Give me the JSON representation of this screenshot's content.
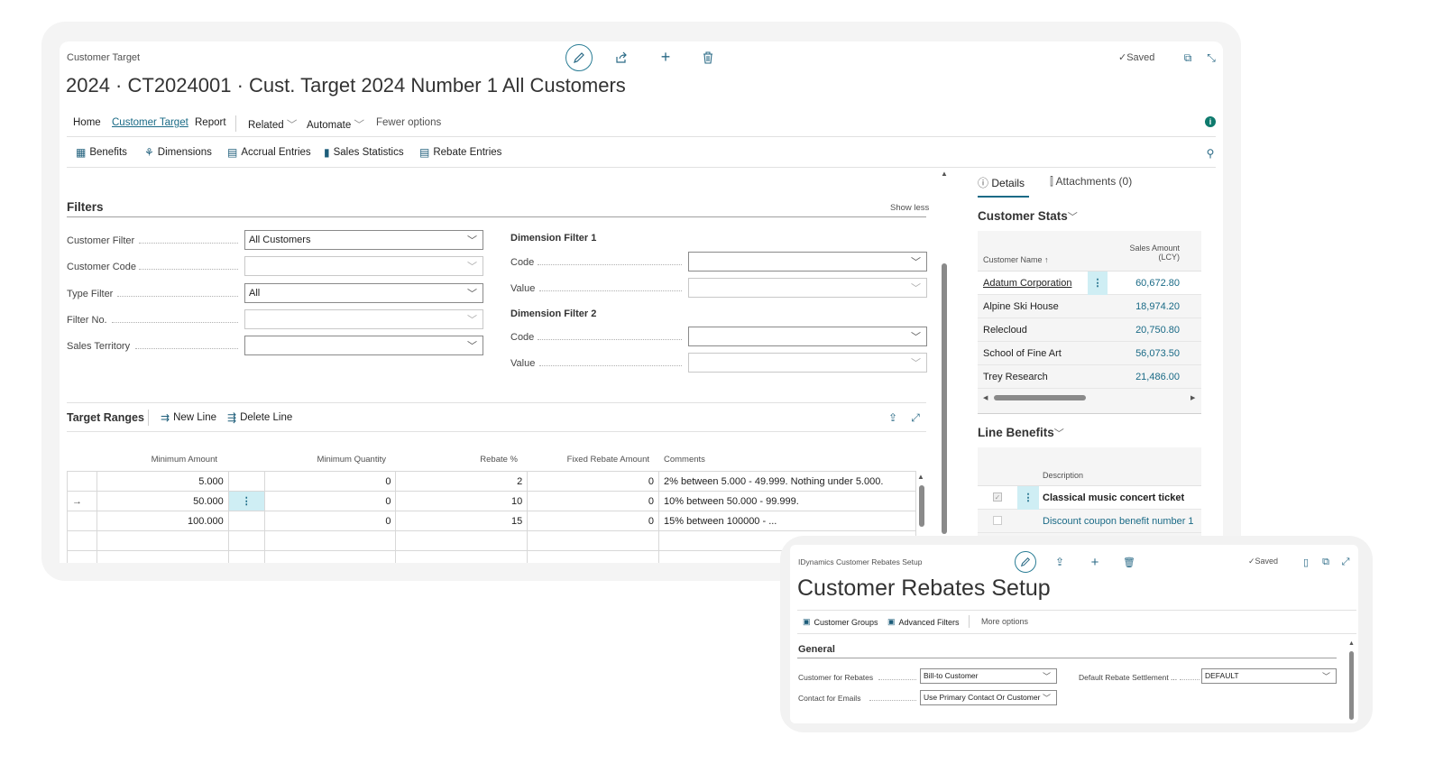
{
  "main": {
    "breadcrumb": "Customer Target",
    "title": "2024 · CT2024001 · Cust. Target 2024 Number 1 All Customers",
    "saved": "Saved",
    "nav": [
      "Home",
      "Customer Target",
      "Report",
      "Related",
      "Automate",
      "Fewer options"
    ],
    "actions": [
      "Benefits",
      "Dimensions",
      "Accrual Entries",
      "Sales Statistics",
      "Rebate Entries"
    ],
    "filters": {
      "title": "Filters",
      "show_less": "Show less",
      "customer_filter_label": "Customer Filter",
      "customer_filter_value": "All Customers",
      "customer_code_label": "Customer Code",
      "type_filter_label": "Type Filter",
      "type_filter_value": "All",
      "filter_no_label": "Filter No.",
      "sales_territory_label": "Sales Territory",
      "dim1_title": "Dimension Filter 1",
      "dim2_title": "Dimension Filter 2",
      "code_label": "Code",
      "value_label": "Value"
    },
    "ranges": {
      "title": "Target Ranges",
      "new_line": "New Line",
      "delete_line": "Delete Line",
      "headers": [
        "Minimum Amount",
        "Minimum Quantity",
        "Rebate %",
        "Fixed Rebate Amount",
        "Comments"
      ],
      "rows": [
        {
          "min_amount": "5.000",
          "min_qty": "0",
          "rebate": "2",
          "fixed": "0",
          "comment": "2% between 5.000 - 49.999. Nothing under 5.000."
        },
        {
          "min_amount": "50.000",
          "min_qty": "0",
          "rebate": "10",
          "fixed": "0",
          "comment": "10% between 50.000 - 99.999."
        },
        {
          "min_amount": "100.000",
          "min_qty": "0",
          "rebate": "15",
          "fixed": "0",
          "comment": "15% between 100000 - ..."
        }
      ]
    },
    "factbox": {
      "tab_details": "Details",
      "tab_attachments": "Attachments (0)",
      "customer_stats_title": "Customer Stats",
      "col_name": "Customer Name ↑",
      "col_amount_1": "Sales Amount",
      "col_amount_2": "(LCY)",
      "customers": [
        {
          "name": "Adatum Corporation",
          "amount": "60,672.80"
        },
        {
          "name": "Alpine Ski House",
          "amount": "18,974.20"
        },
        {
          "name": "Relecloud",
          "amount": "20,750.80"
        },
        {
          "name": "School of Fine Art",
          "amount": "56,073.50"
        },
        {
          "name": "Trey Research",
          "amount": "21,486.00"
        }
      ],
      "line_benefits_title": "Line Benefits",
      "col_description": "Description",
      "benefits": [
        {
          "description": "Classical music concert ticket"
        },
        {
          "description": "Discount coupon benefit number 1"
        }
      ]
    }
  },
  "setup": {
    "breadcrumb": "IDynamics Customer Rebates Setup",
    "title": "Customer Rebates Setup",
    "saved": "Saved",
    "actions": [
      "Customer Groups",
      "Advanced Filters",
      "More options"
    ],
    "general_title": "General",
    "customer_for_rebates_label": "Customer for Rebates",
    "customer_for_rebates_value": "Bill-to Customer",
    "contact_for_emails_label": "Contact for Emails",
    "contact_for_emails_value": "Use Primary Contact Or Customer I",
    "default_settlement_label": "Default Rebate Settlement ...",
    "default_settlement_value": "DEFAULT"
  },
  "colors": {
    "accent": "#1a6a86",
    "info": "#0e7a6d",
    "selected_cell": "#cfeef4"
  }
}
